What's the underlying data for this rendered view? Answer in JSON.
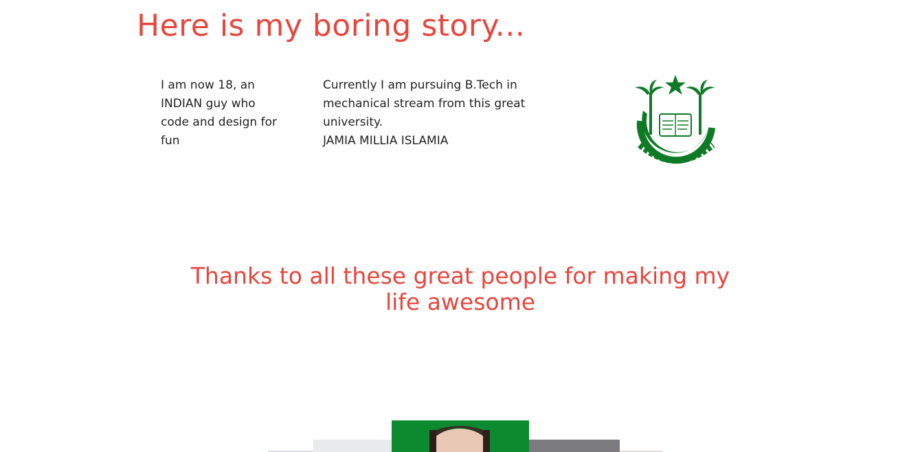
{
  "story": {
    "heading": "Here is my boring story...",
    "col1": "I am now 18, an INDIAN guy who code and design for fun",
    "col2_text": "Currently I am pursuing B.Tech in mechanical stream from this great university.",
    "col2_university": "JAMIA MILLIA ISLAMIA"
  },
  "thanks": {
    "title": "Thanks to all these great people for making my life awesome"
  },
  "emblem": {
    "icon": "university-emblem-icon",
    "color": "#0e7a26"
  },
  "colors": {
    "accent": "#e8453c",
    "text": "#222222",
    "green": "#0d8a2f"
  }
}
